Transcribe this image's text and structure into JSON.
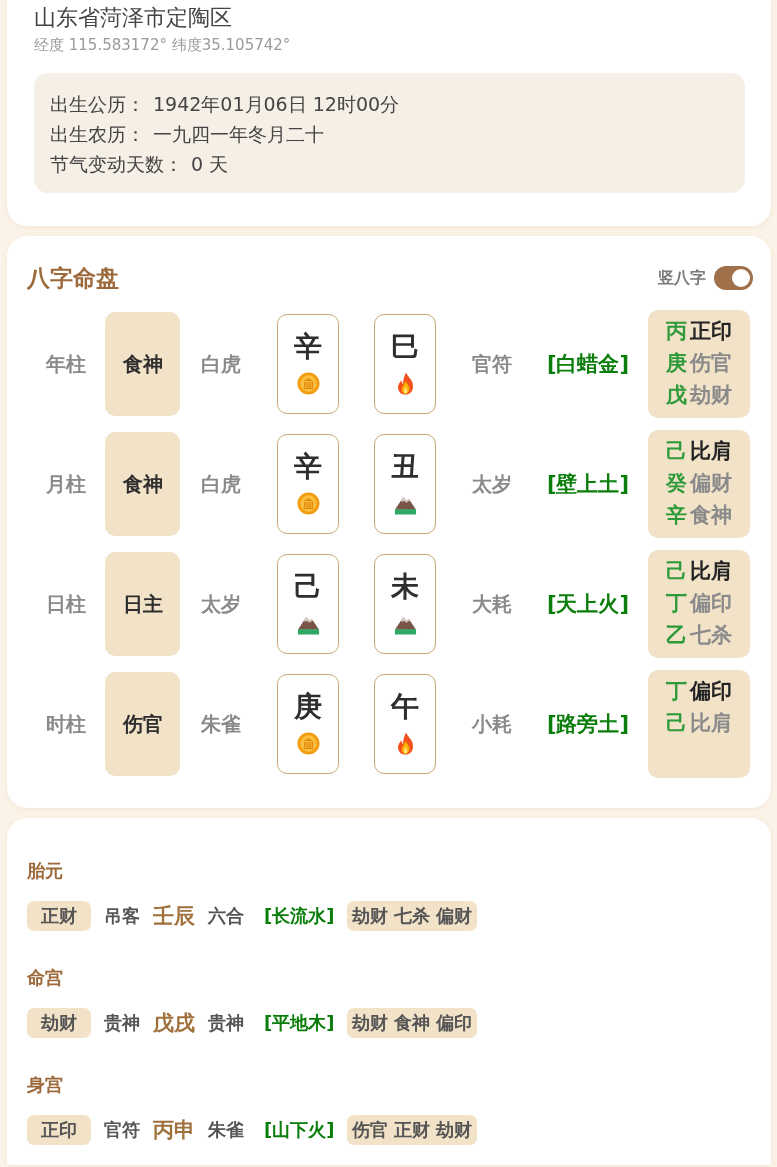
{
  "location": {
    "place": "山东省菏泽市定陶区",
    "coordinates": "经度 115.583172° 纬度35.105742°"
  },
  "birth_info": [
    {
      "label": "出生公历：",
      "value": "1942年01月06日 12时00分"
    },
    {
      "label": "出生农历：",
      "value": "一九四一年冬月二十"
    },
    {
      "label": "节气变动天数：",
      "value": "0 天"
    }
  ],
  "chart": {
    "title": "八字命盘",
    "toggle": {
      "label": "竖八字",
      "on": true
    },
    "pillars": [
      {
        "label": "年柱",
        "ten_god": "食神",
        "shensha_1": "白虎",
        "stem": {
          "char": "辛",
          "kind": "metal"
        },
        "branch": {
          "char": "巳",
          "kind": "fire"
        },
        "shensha_2": "官符",
        "nayin": "[白蜡金]",
        "hidden_stems": [
          {
            "stem": "丙",
            "ten_god": "正印",
            "primary": true
          },
          {
            "stem": "庚",
            "ten_god": "伤官",
            "primary": false
          },
          {
            "stem": "戊",
            "ten_god": "劫财",
            "primary": false
          }
        ]
      },
      {
        "label": "月柱",
        "ten_god": "食神",
        "shensha_1": "白虎",
        "stem": {
          "char": "辛",
          "kind": "metal"
        },
        "branch": {
          "char": "丑",
          "kind": "earth"
        },
        "shensha_2": "太岁",
        "nayin": "[壁上土]",
        "hidden_stems": [
          {
            "stem": "己",
            "ten_god": "比肩",
            "primary": true
          },
          {
            "stem": "癸",
            "ten_god": "偏财",
            "primary": false
          },
          {
            "stem": "辛",
            "ten_god": "食神",
            "primary": false
          }
        ]
      },
      {
        "label": "日柱",
        "ten_god": "日主",
        "shensha_1": "太岁",
        "stem": {
          "char": "己",
          "kind": "earth"
        },
        "branch": {
          "char": "未",
          "kind": "earth"
        },
        "shensha_2": "大耗",
        "nayin": "[天上火]",
        "hidden_stems": [
          {
            "stem": "己",
            "ten_god": "比肩",
            "primary": true
          },
          {
            "stem": "丁",
            "ten_god": "偏印",
            "primary": false
          },
          {
            "stem": "乙",
            "ten_god": "七杀",
            "primary": false
          }
        ]
      },
      {
        "label": "时柱",
        "ten_god": "伤官",
        "shensha_1": "朱雀",
        "stem": {
          "char": "庚",
          "kind": "metal"
        },
        "branch": {
          "char": "午",
          "kind": "fire"
        },
        "shensha_2": "小耗",
        "nayin": "[路旁土]",
        "hidden_stems": [
          {
            "stem": "丁",
            "ten_god": "偏印",
            "primary": true
          },
          {
            "stem": "己",
            "ten_god": "比肩",
            "primary": false
          }
        ]
      }
    ]
  },
  "palaces": [
    {
      "title": "胎元",
      "ten_god": "正财",
      "star_1": "吊客",
      "ganzhi": "壬辰",
      "star_2": "六合",
      "nayin": "[长流水]",
      "ten_gods": [
        "劫财",
        "七杀",
        "偏财"
      ]
    },
    {
      "title": "命宫",
      "ten_god": "劫财",
      "star_1": "贵神",
      "ganzhi": "戊戌",
      "star_2": "贵神",
      "nayin": "[平地木]",
      "ten_gods": [
        "劫财",
        "食神",
        "偏印"
      ]
    },
    {
      "title": "身宫",
      "ten_god": "正印",
      "star_1": "官符",
      "ganzhi": "丙申",
      "star_2": "朱雀",
      "nayin": "[山下火]",
      "ten_gods": [
        "伤官",
        "正财",
        "劫财"
      ]
    }
  ]
}
